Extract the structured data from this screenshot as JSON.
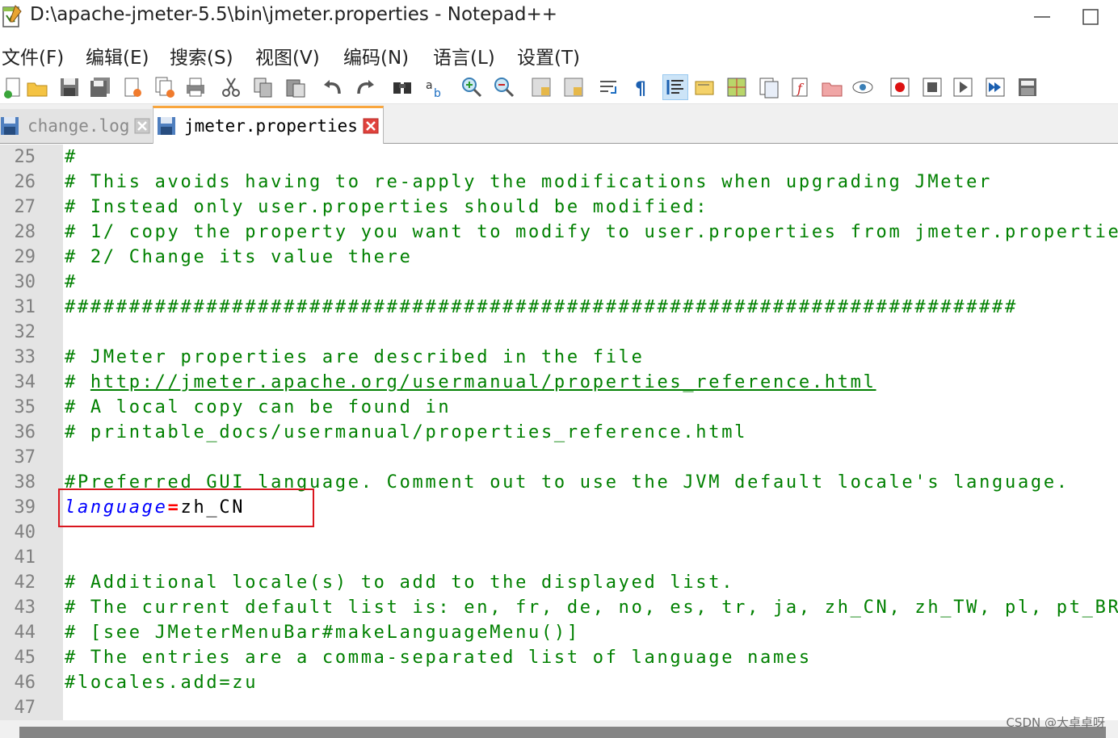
{
  "window": {
    "title": "D:\\apache-jmeter-5.5\\bin\\jmeter.properties - Notepad++",
    "minimize": "—",
    "maximize": "☐"
  },
  "menu": [
    "文件(F)",
    "编辑(E)",
    "搜索(S)",
    "视图(V)",
    "编码(N)",
    "语言(L)",
    "设置(T)"
  ],
  "toolbar": {
    "icons": [
      "new-file-icon",
      "open-file-icon",
      "save-icon",
      "save-all-icon",
      "close-icon",
      "close-all-icon",
      "print-icon",
      "cut-icon",
      "copy-icon",
      "paste-icon",
      "undo-icon",
      "redo-icon",
      "find-icon",
      "replace-icon",
      "zoom-in-icon",
      "zoom-out-icon",
      "sync-vertical-icon",
      "sync-horizontal-icon",
      "word-wrap-icon",
      "show-all-chars-icon",
      "indent-guide-icon",
      "user-language-icon",
      "doc-map-icon",
      "doc-list-icon",
      "function-list-icon",
      "folder-workspace-icon",
      "monitoring-icon",
      "record-macro-icon",
      "stop-macro-icon",
      "play-macro-icon",
      "run-macro-multiple-icon",
      "save-macro-icon"
    ],
    "active_index": 20
  },
  "tabs": [
    {
      "label": "change.log",
      "active": false
    },
    {
      "label": "jmeter.properties",
      "active": true
    }
  ],
  "editor": {
    "lines": [
      {
        "n": "25",
        "type": "comment",
        "text": "#"
      },
      {
        "n": "26",
        "type": "comment",
        "text": "# This avoids having to re-apply the modifications when upgrading JMeter"
      },
      {
        "n": "27",
        "type": "comment",
        "text": "# Instead only user.properties should be modified:"
      },
      {
        "n": "28",
        "type": "comment",
        "text": "# 1/ copy the property you want to modify to user.properties from jmeter.propertie"
      },
      {
        "n": "29",
        "type": "comment",
        "text": "# 2/ Change its value there"
      },
      {
        "n": "30",
        "type": "comment",
        "text": "#"
      },
      {
        "n": "31",
        "type": "comment",
        "text": "##########################################################################"
      },
      {
        "n": "32",
        "type": "empty",
        "text": ""
      },
      {
        "n": "33",
        "type": "comment",
        "text": "# JMeter properties are described in the file"
      },
      {
        "n": "34",
        "type": "link",
        "prefix": "# ",
        "text": "http://jmeter.apache.org/usermanual/properties_reference.html"
      },
      {
        "n": "35",
        "type": "comment",
        "text": "# A local copy can be found in"
      },
      {
        "n": "36",
        "type": "comment",
        "text": "# printable_docs/usermanual/properties_reference.html"
      },
      {
        "n": "37",
        "type": "empty",
        "text": ""
      },
      {
        "n": "38",
        "type": "comment",
        "text": "#Preferred GUI language. Comment out to use the JVM default locale's language."
      },
      {
        "n": "39",
        "type": "property",
        "key": "language",
        "eq": "=",
        "value": "zh_CN"
      },
      {
        "n": "40",
        "type": "empty",
        "text": ""
      },
      {
        "n": "41",
        "type": "empty",
        "text": ""
      },
      {
        "n": "42",
        "type": "comment",
        "text": "# Additional locale(s) to add to the displayed list."
      },
      {
        "n": "43",
        "type": "comment",
        "text": "# The current default list is: en, fr, de, no, es, tr, ja, zh_CN, zh_TW, pl, pt_BR"
      },
      {
        "n": "44",
        "type": "comment",
        "text": "# [see JMeterMenuBar#makeLanguageMenu()]"
      },
      {
        "n": "45",
        "type": "comment",
        "text": "# The entries are a comma-separated list of language names"
      },
      {
        "n": "46",
        "type": "comment",
        "text": "#locales.add=zu"
      },
      {
        "n": "47",
        "type": "empty",
        "text": ""
      }
    ]
  },
  "watermark": "CSDN @大卓卓呀",
  "colors": {
    "comment": "#008000",
    "key": "#0000ff",
    "operator": "#ff0000",
    "highlight_box": "#d9161e",
    "active_tab_accent": "#f9a63d"
  }
}
